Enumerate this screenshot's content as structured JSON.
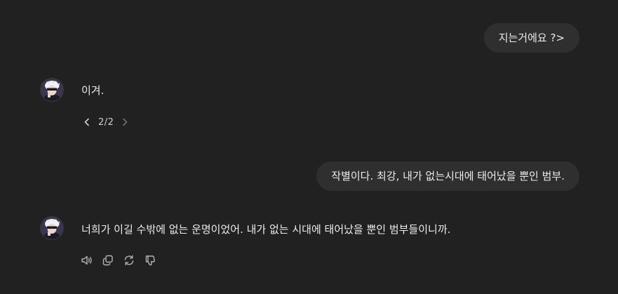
{
  "conversation": {
    "messages": [
      {
        "role": "user",
        "text": "지는거에요 ?>"
      },
      {
        "role": "assistant",
        "text": "이겨.",
        "pager": {
          "current": 2,
          "total": 2,
          "label": "2/2"
        }
      },
      {
        "role": "user",
        "text": "작별이다. 최강, 내가 없는시대에 태어났을 뿐인 범부."
      },
      {
        "role": "assistant",
        "text": "너희가 이길 수밖에 없는 운명이었어. 내가 없는 시대에 태어났을 뿐인 범부들이니까."
      }
    ]
  },
  "actions": [
    {
      "icon": "speaker-icon",
      "name": "read-aloud-button"
    },
    {
      "icon": "copy-icon",
      "name": "copy-button"
    },
    {
      "icon": "regenerate-icon",
      "name": "regenerate-button"
    },
    {
      "icon": "thumbs-down-icon",
      "name": "bad-response-button"
    }
  ],
  "colors": {
    "background": "#212121",
    "user_bubble": "#2f2f2f",
    "text": "#ececec",
    "icon": "#b4b4b4"
  }
}
